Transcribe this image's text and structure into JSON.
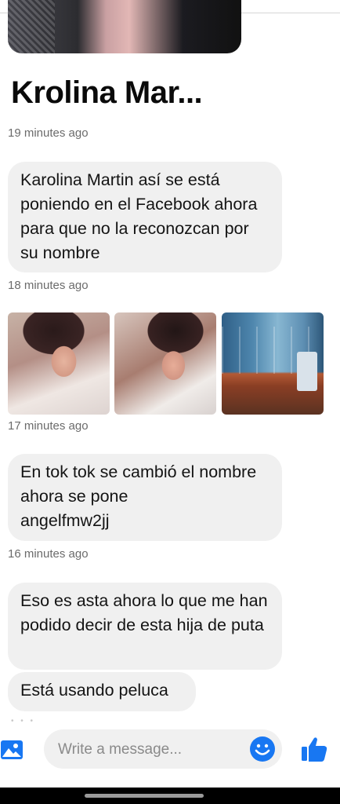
{
  "conversation": {
    "sender_name": "Krolina Mar...",
    "messages": [
      {
        "timestamp": "19 minutes ago",
        "text": "Karolina Martin así se está poniendo en el Facebook ahora para que no la reconozcan por su nombre"
      },
      {
        "timestamp": "18 minutes ago",
        "photos": [
          "photo-woman-selfie-1",
          "photo-woman-selfie-2",
          "photo-waiting-room"
        ]
      },
      {
        "timestamp": "17 minutes ago",
        "text": "En tok tok se cambió el nombre ahora se pone\n angelfmw2jj"
      },
      {
        "timestamp": "16 minutes ago",
        "text": "Eso es asta ahora lo que me han podido decir de esta hija de puta"
      },
      {
        "text": "Está usando peluca"
      }
    ]
  },
  "composer": {
    "placeholder": "Write a message...",
    "icons": {
      "gallery": "gallery-icon",
      "emoji": "emoji-icon",
      "send": "thumbs-up-icon"
    }
  },
  "colors": {
    "accent": "#1877f2",
    "bubble": "#f0f0f0",
    "timestamp": "#6b6b6b"
  }
}
